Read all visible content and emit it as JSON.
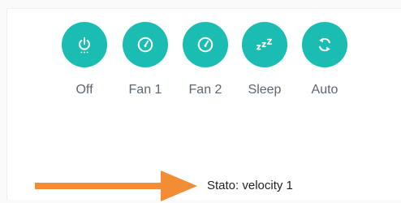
{
  "modes": [
    {
      "label": "Off",
      "icon": "power-icon"
    },
    {
      "label": "Fan 1",
      "icon": "speedometer-icon"
    },
    {
      "label": "Fan 2",
      "icon": "speedometer-icon"
    },
    {
      "label": "Sleep",
      "icon": "sleep-zzz-icon"
    },
    {
      "label": "Auto",
      "icon": "auto-refresh-icon"
    }
  ],
  "status": {
    "text": "Stato: velocity 1"
  },
  "colors": {
    "button_bg": "#1bbdb2",
    "icon": "#ffffff",
    "label": "#5d6670",
    "arrow": "#f28d35",
    "status_text": "#222222"
  }
}
